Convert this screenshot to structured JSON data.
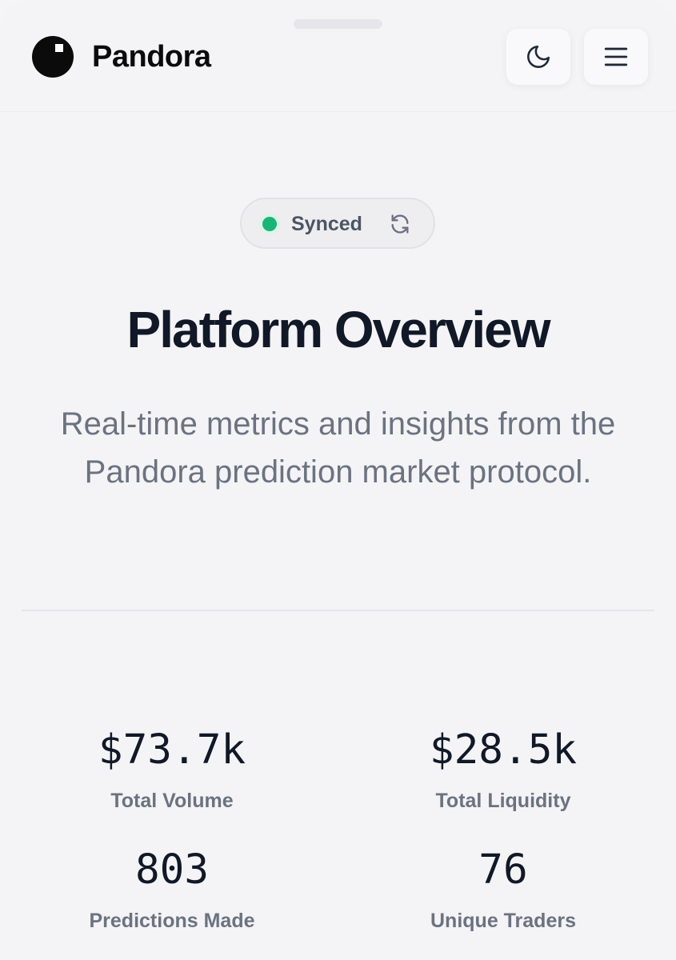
{
  "header": {
    "brand": "Pandora",
    "theme_toggle_icon": "moon-icon",
    "menu_icon": "hamburger-menu-icon"
  },
  "status": {
    "label": "Synced",
    "dot_color": "#19b575",
    "refresh_icon": "refresh-icon"
  },
  "hero": {
    "title": "Platform Overview",
    "subtitle": "Real-time metrics and insights from the Pandora prediction market protocol."
  },
  "stats": [
    {
      "value": "$73.7k",
      "label": "Total Volume"
    },
    {
      "value": "$28.5k",
      "label": "Total Liquidity"
    },
    {
      "value": "803",
      "label": "Predictions Made"
    },
    {
      "value": "76",
      "label": "Unique Traders"
    }
  ]
}
